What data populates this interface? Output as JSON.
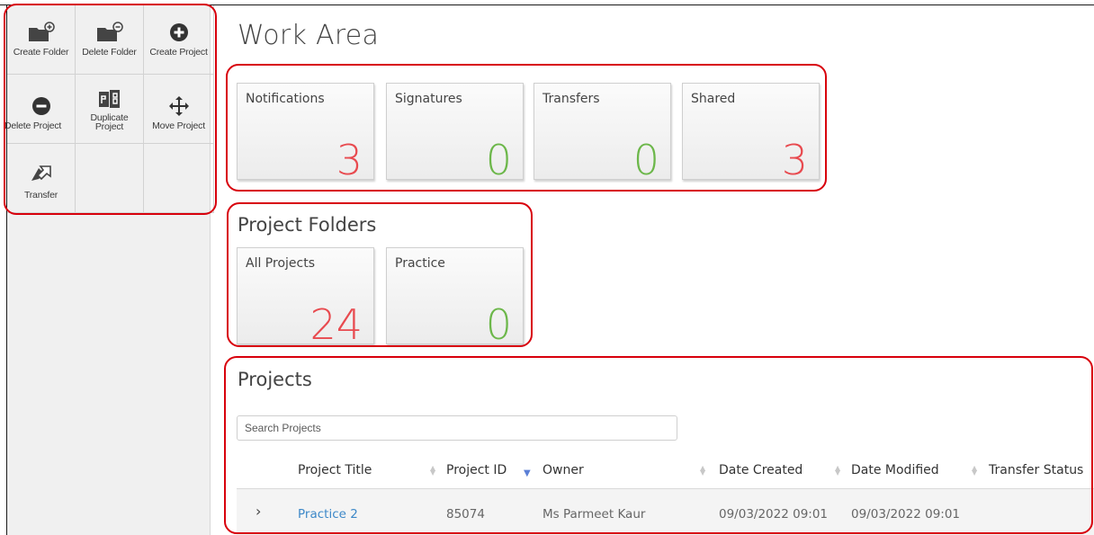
{
  "toolbar": {
    "create_folder": "Create Folder",
    "delete_folder": "Delete Folder",
    "create_project": "Create Project",
    "delete_project": "Delete Project",
    "duplicate_project": "Duplicate Project",
    "move_project": "Move Project",
    "transfer": "Transfer"
  },
  "icons": {
    "create_folder": "folder-plus-icon",
    "delete_folder": "folder-minus-icon",
    "create_project": "plus-circle-icon",
    "delete_project": "minus-circle-icon",
    "duplicate_project": "duplicate-icon",
    "move_project": "move-arrows-icon",
    "transfer": "transfer-arrow-icon"
  },
  "work_area": {
    "title": "Work Area",
    "tiles": [
      {
        "label": "Notifications",
        "count": "3",
        "color": "#e84a4f"
      },
      {
        "label": "Signatures",
        "count": "0",
        "color": "#6cb74a"
      },
      {
        "label": "Transfers",
        "count": "0",
        "color": "#6cb74a"
      },
      {
        "label": "Shared",
        "count": "3",
        "color": "#e84a4f"
      }
    ]
  },
  "project_folders": {
    "title": "Project Folders",
    "tiles": [
      {
        "label": "All Projects",
        "count": "24",
        "color": "#e84a4f"
      },
      {
        "label": "Practice",
        "count": "0",
        "color": "#6cb74a"
      }
    ]
  },
  "projects": {
    "title": "Projects",
    "search_placeholder": "Search Projects",
    "columns": [
      "Project Title",
      "Project ID",
      "Owner",
      "Date Created",
      "Date Modified",
      "Transfer Status"
    ],
    "sorted_column": "Project ID",
    "rows": [
      {
        "title": "Practice 2",
        "id": "85074",
        "owner": "Ms Parmeet Kaur",
        "created": "09/03/2022 09:01",
        "modified": "09/03/2022 09:01",
        "transfer_status": ""
      }
    ]
  },
  "colors": {
    "highlight": "#d8000c",
    "count_red": "#e84a4f",
    "count_green": "#6cb74a",
    "link": "#3d88c8"
  }
}
